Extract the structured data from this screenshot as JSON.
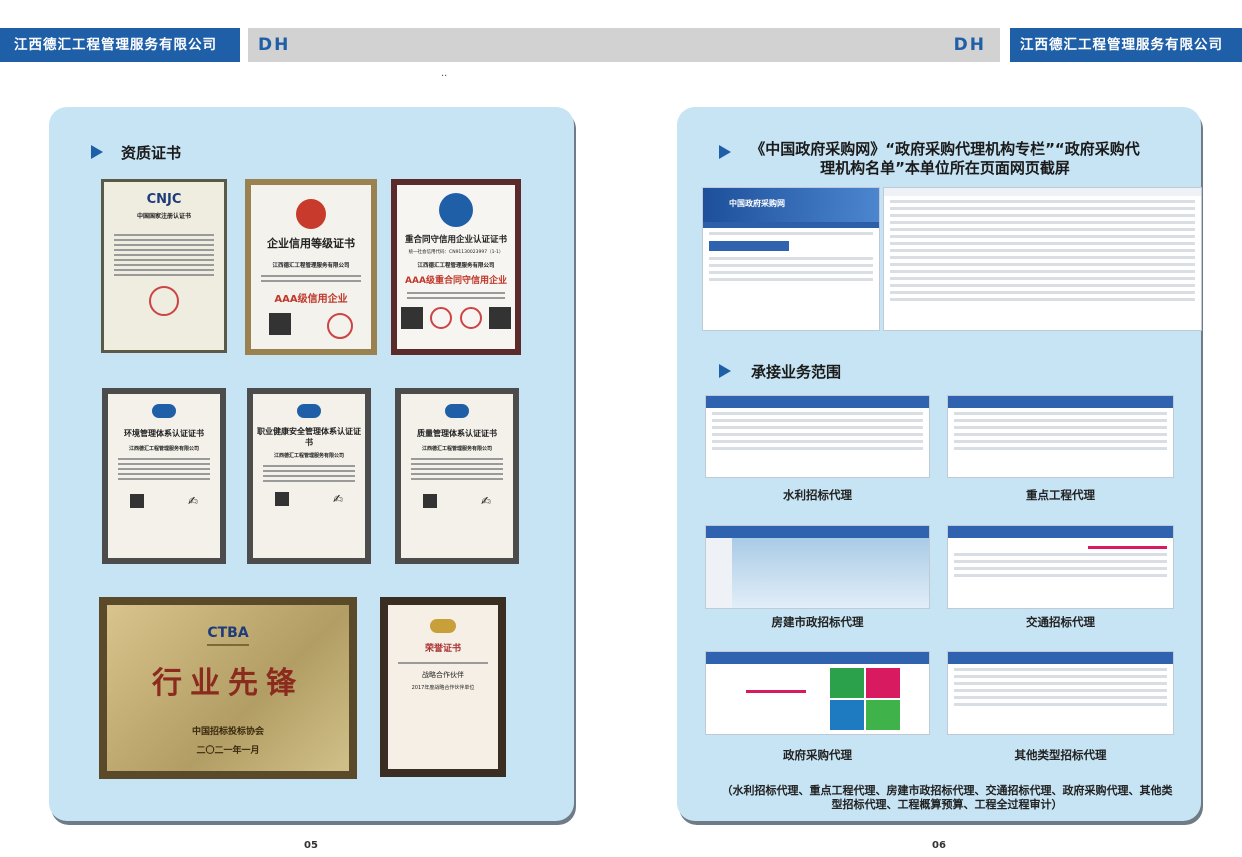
{
  "header": {
    "company_left": "江西德汇工程管理服务有限公司",
    "logo_left": "DH",
    "logo_right": "DH",
    "company_right": "江西德汇工程管理服务有限公司",
    "dots": "..",
    "brand_color": "#1f5fa8"
  },
  "left_page": {
    "section_title": "资质证书",
    "page_number": "05",
    "certificates": [
      {
        "title": "中国国家注册认证书",
        "logo": "CNJC"
      },
      {
        "title": "企业信用等级证书",
        "company": "江西德汇工程管理服务有限公司",
        "grade": "AAA级信用企业"
      },
      {
        "title": "重合同守信用企业认证证书",
        "code": "统一社会信用代码：CN91130023997（1-1）",
        "company": "江西德汇工程管理服务有限公司",
        "grade": "AAA级重合同守信用企业"
      },
      {
        "title": "环境管理体系认证证书",
        "company": "江西德汇工程管理服务有限公司"
      },
      {
        "title": "职业健康安全管理体系认证证书",
        "company": "江西德汇工程管理服务有限公司"
      },
      {
        "title": "质量管理体系认证证书",
        "company": "江西德汇工程管理服务有限公司"
      },
      {
        "brand": "CTBA",
        "title": "行业先锋",
        "issuer": "中国招标投标协会",
        "date": "二〇二一年一月"
      },
      {
        "title": "荣誉证书",
        "line1": "战略合作伙伴",
        "line2": "2017年度战略合作伙伴单位"
      }
    ]
  },
  "right_page": {
    "section1_title": "《中国政府采购网》“政府采购代理机构专栏”“政府采购代理机构名单”本单位所在页面网页截屏",
    "section2_title": "承接业务范围",
    "page_number": "06",
    "gov_site_name": "中国政府采购网",
    "screenshots": [
      {
        "caption": "水利招标代理"
      },
      {
        "caption": "重点工程代理"
      },
      {
        "caption": "房建市政招标代理"
      },
      {
        "caption": "交通招标代理"
      },
      {
        "caption": "政府采购代理"
      },
      {
        "caption": "其他类型招标代理"
      }
    ],
    "note": "（水利招标代理、重点工程代理、房建市政招标代理、交通招标代理、政府采购代理、其他类型招标代理、工程概算预算、工程全过程审计）"
  }
}
